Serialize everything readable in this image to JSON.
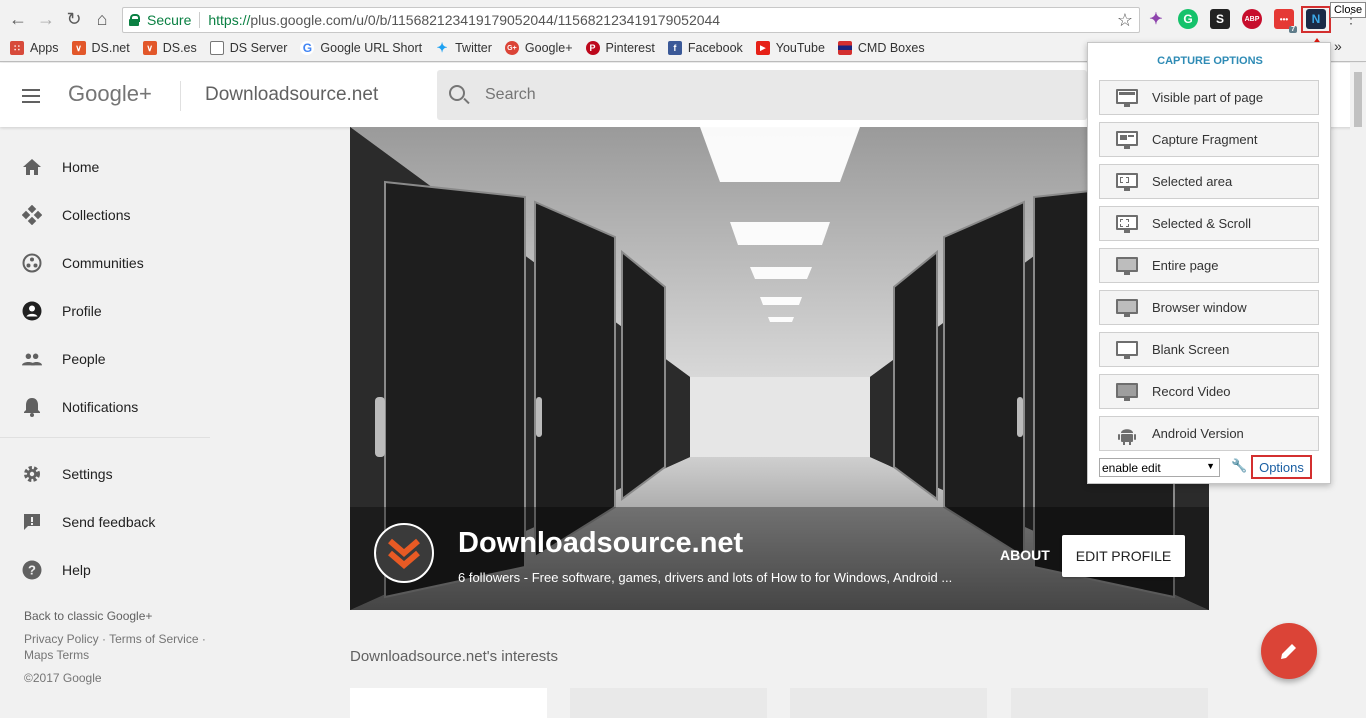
{
  "browser": {
    "secure_label": "Secure",
    "url_https": "https://",
    "url_rest": "plus.google.com/u/0/b/115682123419179052044/115682123419179052044",
    "close_tooltip": "Close",
    "ext_badge": "7",
    "ext_labels": {
      "s": "S",
      "abp": "ABP",
      "dots": "•••"
    }
  },
  "bookmarks": [
    {
      "label": "Apps",
      "icon": "apps-grid-icon",
      "color": "#d74a3b"
    },
    {
      "label": "DS.net",
      "icon": "ds-net-icon",
      "color": "#e2572a"
    },
    {
      "label": "DS.es",
      "icon": "ds-es-icon",
      "color": "#e2572a"
    },
    {
      "label": "DS Server",
      "icon": "page-icon",
      "color": "#9e9e9e"
    },
    {
      "label": "Google URL Short",
      "icon": "google-icon",
      "color": "#4285f4"
    },
    {
      "label": "Twitter",
      "icon": "twitter-icon",
      "color": "#1da1f2"
    },
    {
      "label": "Google+",
      "icon": "google-plus-icon",
      "color": "#db4437"
    },
    {
      "label": "Pinterest",
      "icon": "pinterest-icon",
      "color": "#bd081c"
    },
    {
      "label": "Facebook",
      "icon": "facebook-icon",
      "color": "#3b5998"
    },
    {
      "label": "YouTube",
      "icon": "youtube-icon",
      "color": "#e62117"
    },
    {
      "label": "CMD Boxes",
      "icon": "cmd-boxes-icon",
      "color": "#1a237e"
    }
  ],
  "header": {
    "logo": "Google+",
    "page_title": "Downloadsource.net",
    "search_placeholder": "Search"
  },
  "sidebar": {
    "items": [
      {
        "label": "Home",
        "icon": "home-icon"
      },
      {
        "label": "Collections",
        "icon": "collections-icon"
      },
      {
        "label": "Communities",
        "icon": "communities-icon"
      },
      {
        "label": "Profile",
        "icon": "profile-icon"
      },
      {
        "label": "People",
        "icon": "people-icon"
      },
      {
        "label": "Notifications",
        "icon": "bell-icon"
      }
    ],
    "items2": [
      {
        "label": "Settings",
        "icon": "gear-icon"
      },
      {
        "label": "Send feedback",
        "icon": "feedback-icon"
      },
      {
        "label": "Help",
        "icon": "help-icon"
      }
    ],
    "back_classic": "Back to classic Google+",
    "legal_line1": "Privacy Policy · Terms of Service ·",
    "legal_line2": "Maps Terms",
    "copyright": "©2017 Google"
  },
  "profile": {
    "name": "Downloadsource.net",
    "subtitle": "6 followers - Free software, games, drivers and lots of How to for Windows, Android ...",
    "about_label": "ABOUT",
    "edit_label": "EDIT PROFILE",
    "interests_title": "Downloadsource.net's interests"
  },
  "capture_popup": {
    "title": "CAPTURE OPTIONS",
    "buttons": [
      {
        "label": "Visible part of page",
        "icon": "visible-page-icon"
      },
      {
        "label": "Capture Fragment",
        "icon": "fragment-icon"
      },
      {
        "label": "Selected area",
        "icon": "selected-area-icon"
      },
      {
        "label": "Selected & Scroll",
        "icon": "selected-scroll-icon"
      },
      {
        "label": "Entire page",
        "icon": "entire-page-icon"
      },
      {
        "label": "Browser window",
        "icon": "browser-window-icon"
      },
      {
        "label": "Blank Screen",
        "icon": "blank-screen-icon"
      },
      {
        "label": "Record Video",
        "icon": "record-video-icon"
      },
      {
        "label": "Android Version",
        "icon": "android-icon"
      }
    ],
    "select_value": "enable edit",
    "options_label": "Options"
  },
  "colors": {
    "accent_red": "#db4437",
    "popup_title": "#2e8bb5",
    "secure_green": "#0b8043"
  }
}
